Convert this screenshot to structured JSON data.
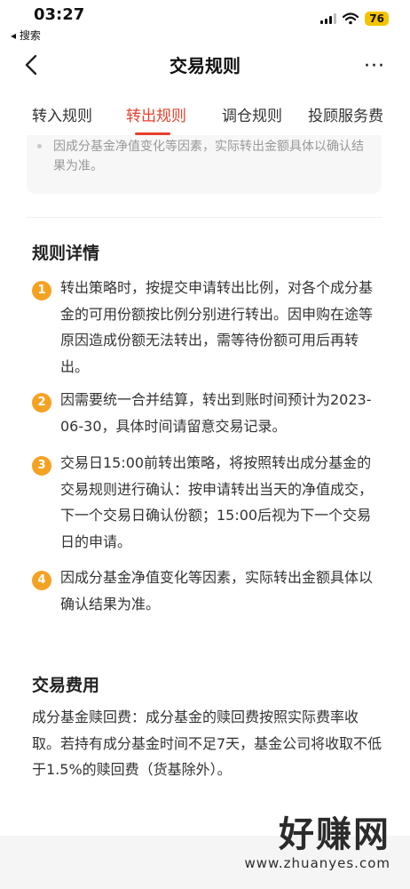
{
  "status_bar": {
    "time": "03:27",
    "back_label": "◂ 搜索",
    "battery": "76"
  },
  "header": {
    "title": "交易规则",
    "more": "···"
  },
  "tabs": [
    {
      "label": "转入规则",
      "active": false
    },
    {
      "label": "转出规则",
      "active": true
    },
    {
      "label": "调仓规则",
      "active": false
    },
    {
      "label": "投顾服务费",
      "active": false
    }
  ],
  "note": {
    "text": "因成分基金净值变化等因素，实际转出金额具体以确认结果为准。"
  },
  "rules_section": {
    "title": "规则详情",
    "items": [
      {
        "num": "1",
        "text": "转出策略时，按提交申请转出比例，对各个成分基金的可用份额按比例分别进行转出。因申购在途等原因造成份额无法转出，需等待份额可用后再转出。"
      },
      {
        "num": "2",
        "text": "因需要统一合并结算，转出到账时间预计为2023-06-30，具体时间请留意交易记录。"
      },
      {
        "num": "3",
        "text": "交易日15:00前转出策略，将按照转出成分基金的交易规则进行确认：按申请转出当天的净值成交，下一个交易日确认份额；15:00后视为下一个交易日的申请。"
      },
      {
        "num": "4",
        "text": "因成分基金净值变化等因素，实际转出金额具体以确认结果为准。"
      }
    ]
  },
  "fee_section": {
    "title": "交易费用",
    "text": "成分基金赎回费：成分基金的赎回费按照实际费率收取。若持有成分基金时间不足7天，基金公司将收取不低于1.5%的赎回费（货基除外）。"
  },
  "watermark": {
    "brand": "好赚网",
    "url": "www.zhuanyes.com"
  },
  "colors": {
    "accent": "#e8402c",
    "badge": "#f5a223",
    "battery": "#f5c400"
  },
  "icons": [
    "signal-icon",
    "wifi-icon",
    "back-arrow-icon",
    "more-icon"
  ]
}
